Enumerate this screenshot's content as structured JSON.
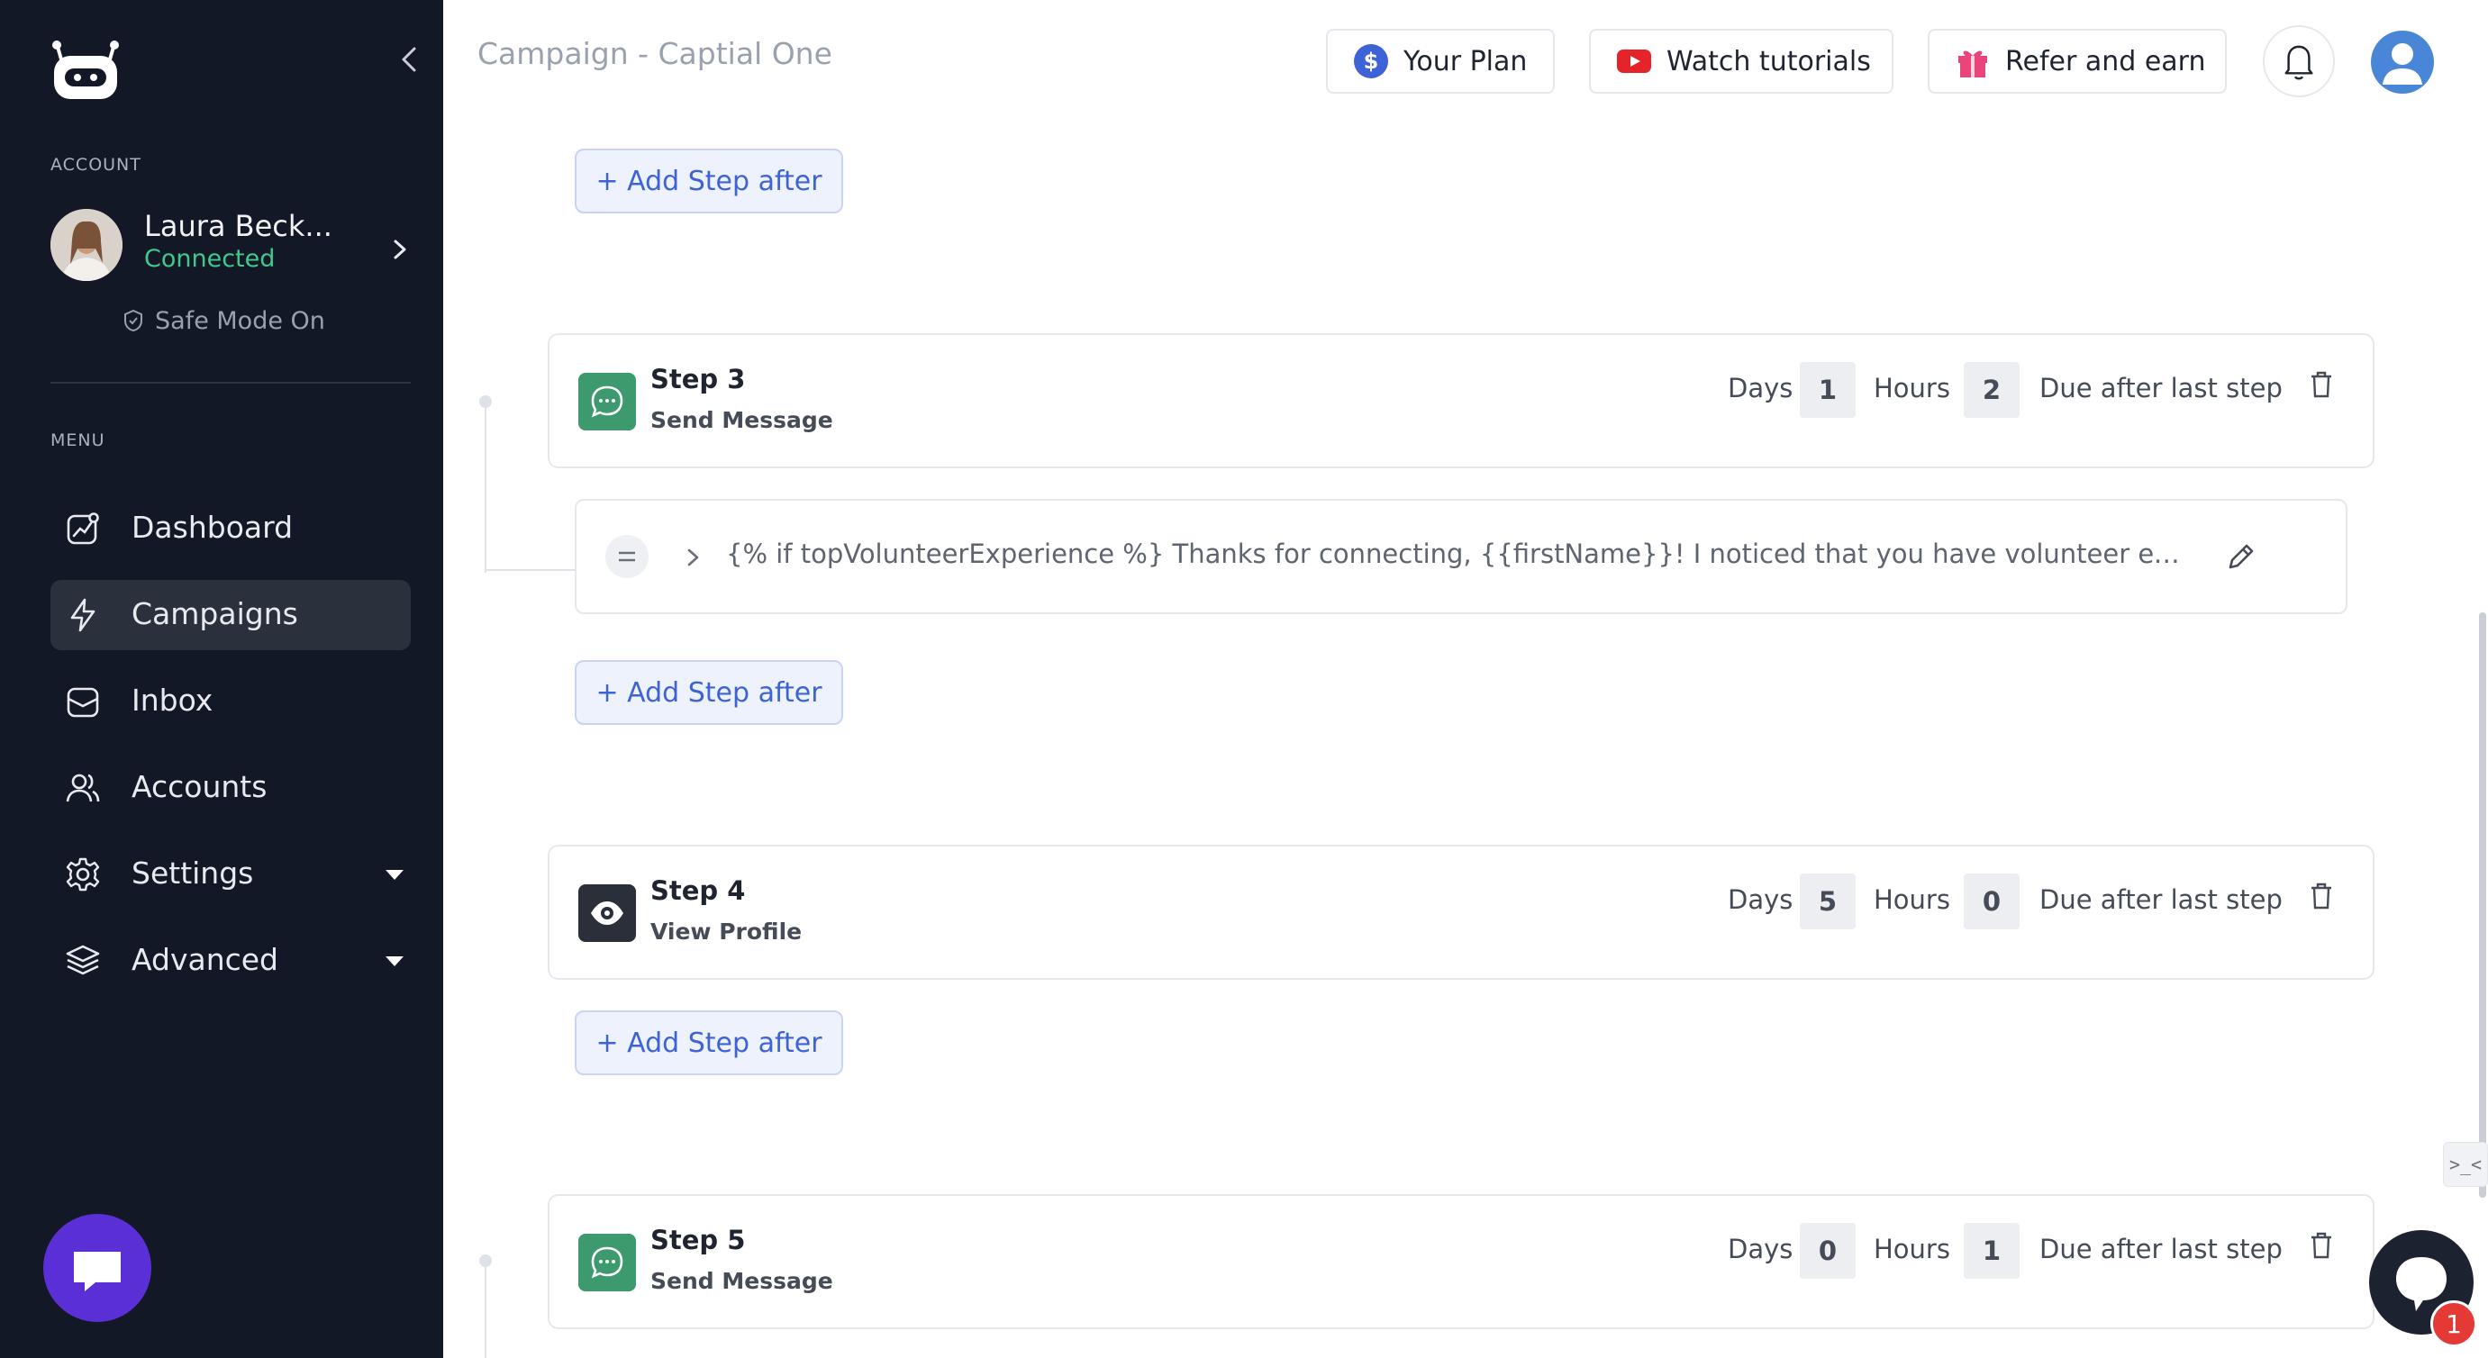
{
  "sidebar": {
    "account_section": "ACCOUNT",
    "account": {
      "name": "Laura Beck...",
      "status": "Connected",
      "safe_mode": "Safe Mode On"
    },
    "menu_section": "MENU",
    "items": [
      {
        "label": "Dashboard",
        "icon": "dashboard-icon"
      },
      {
        "label": "Campaigns",
        "icon": "lightning-icon",
        "active": true
      },
      {
        "label": "Inbox",
        "icon": "inbox-icon"
      },
      {
        "label": "Accounts",
        "icon": "users-icon"
      },
      {
        "label": "Settings",
        "icon": "gear-icon",
        "has_dropdown": true
      },
      {
        "label": "Advanced",
        "icon": "layers-icon",
        "has_dropdown": true
      }
    ]
  },
  "header": {
    "title": "Campaign - Captial One",
    "your_plan": "Your Plan",
    "watch_tutorials": "Watch tutorials",
    "refer_and_earn": "Refer and earn"
  },
  "add_step_label": "+ Add Step after",
  "steps": [
    {
      "title": "Step 3",
      "action": "Send Message",
      "days_label": "Days",
      "days": "1",
      "hours_label": "Hours",
      "hours": "2",
      "due": "Due after last step",
      "message_preview": "{% if topVolunteerExperience %} Thanks for connecting, {{firstName}}! I noticed that you have volunteer experienc..."
    },
    {
      "title": "Step 4",
      "action": "View Profile",
      "days_label": "Days",
      "days": "5",
      "hours_label": "Hours",
      "hours": "0",
      "due": "Due after last step"
    },
    {
      "title": "Step 5",
      "action": "Send Message",
      "days_label": "Days",
      "days": "0",
      "hours_label": "Hours",
      "hours": "1",
      "due": "Due after last step"
    }
  ],
  "devtools_label": ">_<",
  "help_badge_count": "1",
  "colors": {
    "sidebar_bg": "#121826",
    "connected_green": "#3fc98a",
    "accent_blue": "#3e63d6",
    "message_step_green": "#3c9a6e",
    "chat_purple": "#5b2fd6",
    "badge_red": "#e53935"
  }
}
